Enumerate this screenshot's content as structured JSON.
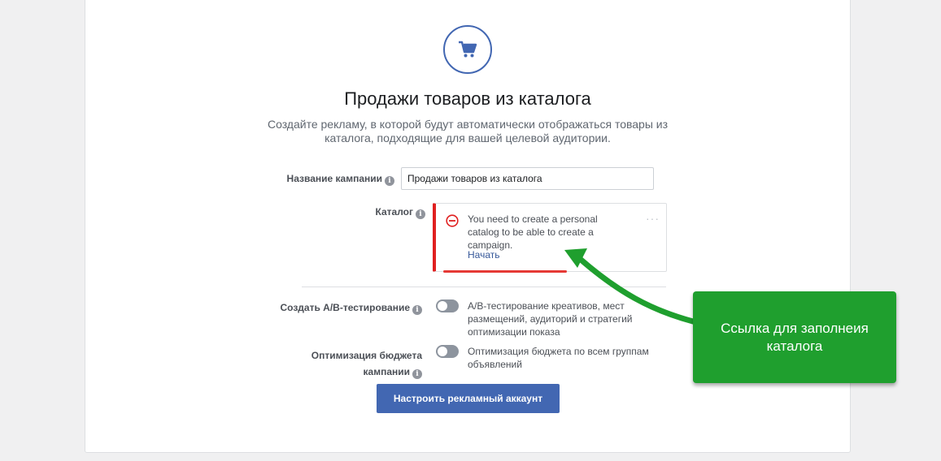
{
  "page": {
    "title": "Продажи товаров из каталога",
    "subtitle": "Создайте рекламу, в которой будут автоматически отображаться товары из каталога, подходящие для вашей целевой аудитории."
  },
  "form": {
    "campaign_name_label": "Название кампании",
    "campaign_name_value": "Продажи товаров из каталога",
    "catalog_label": "Каталог",
    "catalog_error": "You need to create a personal catalog to be able to create a campaign.",
    "catalog_more": "···",
    "catalog_start_link": "Начать",
    "ab_test_label": "Создать A/B-тестирование",
    "ab_test_desc": "A/B-тестирование креативов, мест размещений, аудиторий и стратегий оптимизации показа",
    "budget_label_line1": "Оптимизация бюджета",
    "budget_label_line2": "кампании",
    "budget_desc": "Оптимизация бюджета по всем группам объявлений",
    "submit_label": "Настроить рекламный аккаунт"
  },
  "annotation": {
    "callout_text": "Ссылка для заполнеия каталога"
  },
  "colors": {
    "accent": "#4267b2",
    "error": "#e02020",
    "callout": "#1f9f2e",
    "link": "#365899"
  },
  "icons": {
    "header": "shopping-cart-icon",
    "info": "info-icon",
    "error": "minus-circle-icon",
    "more": "more-dots-icon"
  }
}
